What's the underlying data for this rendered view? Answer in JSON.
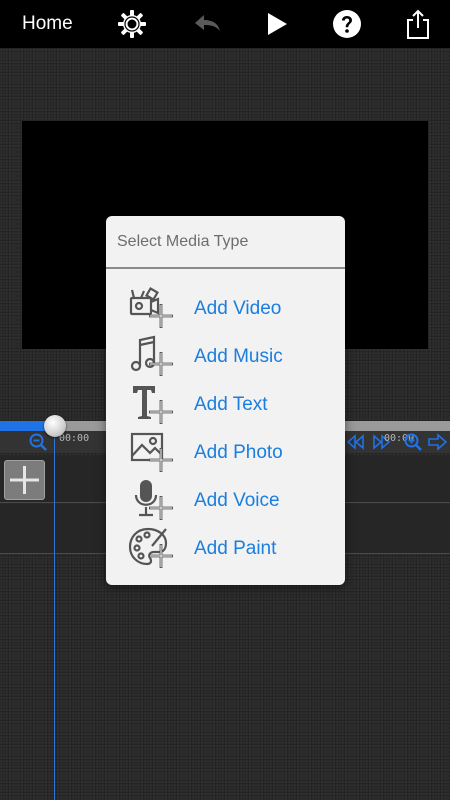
{
  "toolbar": {
    "home_label": "Home",
    "icons": [
      "gear-icon",
      "undo-icon",
      "play-icon",
      "help-icon",
      "share-icon"
    ]
  },
  "timeline": {
    "start_time": "00:00",
    "end_time": "00:00",
    "playhead_progress": 0.0
  },
  "popup": {
    "title": "Select Media Type",
    "items": [
      {
        "label": "Add Video",
        "icon": "video-camera-icon"
      },
      {
        "label": "Add Music",
        "icon": "music-note-icon"
      },
      {
        "label": "Add Text",
        "icon": "text-icon"
      },
      {
        "label": "Add Photo",
        "icon": "photo-icon"
      },
      {
        "label": "Add Voice",
        "icon": "microphone-icon"
      },
      {
        "label": "Add Paint",
        "icon": "palette-icon"
      }
    ]
  },
  "colors": {
    "accent": "#1a7ee0",
    "toolbar_bg": "#000000",
    "popup_bg": "#f2f2f2",
    "timeline_fill": "#1f73e6"
  }
}
